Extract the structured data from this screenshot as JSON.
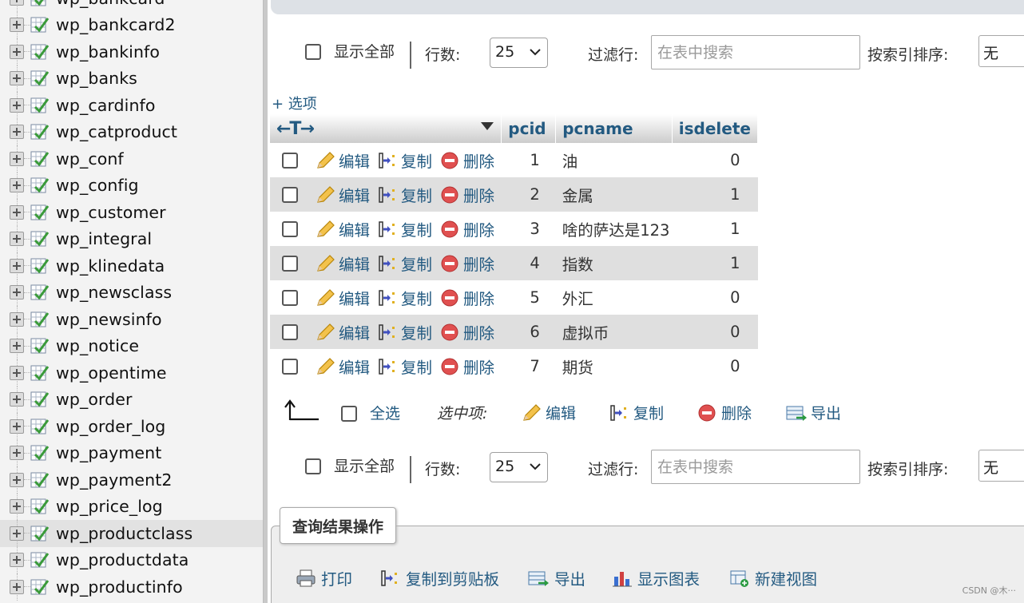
{
  "sidebar": {
    "tables": [
      {
        "name": "wp_bankcard",
        "active": false
      },
      {
        "name": "wp_bankcard2",
        "active": false
      },
      {
        "name": "wp_bankinfo",
        "active": false
      },
      {
        "name": "wp_banks",
        "active": false
      },
      {
        "name": "wp_cardinfo",
        "active": false
      },
      {
        "name": "wp_catproduct",
        "active": false
      },
      {
        "name": "wp_conf",
        "active": false
      },
      {
        "name": "wp_config",
        "active": false
      },
      {
        "name": "wp_customer",
        "active": false
      },
      {
        "name": "wp_integral",
        "active": false
      },
      {
        "name": "wp_klinedata",
        "active": false
      },
      {
        "name": "wp_newsclass",
        "active": false
      },
      {
        "name": "wp_newsinfo",
        "active": false
      },
      {
        "name": "wp_notice",
        "active": false
      },
      {
        "name": "wp_opentime",
        "active": false
      },
      {
        "name": "wp_order",
        "active": false
      },
      {
        "name": "wp_order_log",
        "active": false
      },
      {
        "name": "wp_payment",
        "active": false
      },
      {
        "name": "wp_payment2",
        "active": false
      },
      {
        "name": "wp_price_log",
        "active": false
      },
      {
        "name": "wp_productclass",
        "active": true
      },
      {
        "name": "wp_productdata",
        "active": false
      },
      {
        "name": "wp_productinfo",
        "active": false
      }
    ]
  },
  "nav": {
    "show_all": "显示全部",
    "rows_label": "行数:",
    "rows_value": "25",
    "filter_label": "过滤行:",
    "filter_placeholder": "在表中搜索",
    "sort_label": "按索引排序:",
    "sort_value": "无"
  },
  "options_link": "+ 选项",
  "table": {
    "col_arrows": "←T→",
    "columns": [
      "pcid",
      "pcname",
      "isdelete"
    ],
    "actions": {
      "edit": "编辑",
      "copy": "复制",
      "delete": "删除"
    },
    "rows": [
      {
        "pcid": "1",
        "pcname": "油",
        "isdelete": "0"
      },
      {
        "pcid": "2",
        "pcname": "金属",
        "isdelete": "1"
      },
      {
        "pcid": "3",
        "pcname": "啥的萨达是123",
        "isdelete": "1"
      },
      {
        "pcid": "4",
        "pcname": "指数",
        "isdelete": "1"
      },
      {
        "pcid": "5",
        "pcname": "外汇",
        "isdelete": "0"
      },
      {
        "pcid": "6",
        "pcname": "虚拟币",
        "isdelete": "0"
      },
      {
        "pcid": "7",
        "pcname": "期货",
        "isdelete": "0"
      }
    ]
  },
  "bulk": {
    "select_all": "全选",
    "with_selected": "选中项:",
    "edit": "编辑",
    "copy": "复制",
    "delete": "删除",
    "export": "导出"
  },
  "query_ops": {
    "title": "查询结果操作",
    "print": "打印",
    "copy_clipboard": "复制到剪贴板",
    "export": "导出",
    "show_chart": "显示图表",
    "create_view": "新建视图"
  },
  "watermark": "CSDN @木···"
}
